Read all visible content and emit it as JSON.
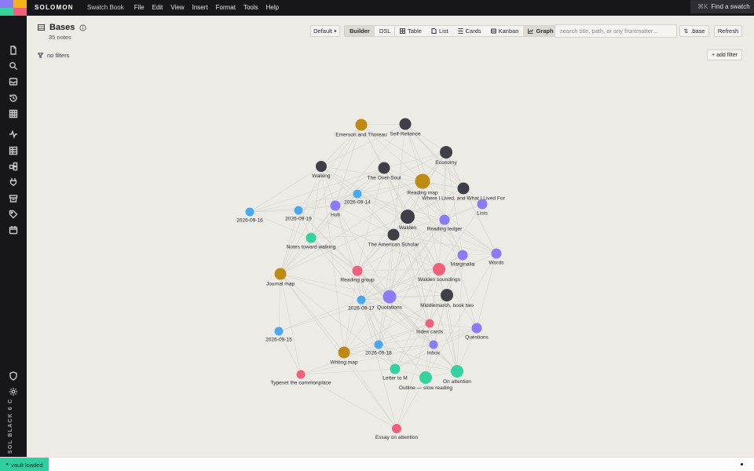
{
  "app": {
    "brand": "SOLOMON",
    "menu": [
      "Swatch Book",
      "File",
      "Edit",
      "View",
      "Insert",
      "Format",
      "Tools",
      "Help"
    ],
    "find_shortcut": "⌘K",
    "find_label": "Find a swatch",
    "logo_colors": [
      "#8b7cf6",
      "#f2b21a",
      "#34d39e",
      "#f0607a"
    ]
  },
  "rail": {
    "icons": [
      "file-icon",
      "search-icon",
      "inbox-icon",
      "history-icon",
      "grid-icon",
      "activity-icon",
      "table-icon",
      "blocks-icon",
      "plug-icon",
      "archive-icon",
      "tag-icon",
      "calendar-icon"
    ],
    "bottom_icons": [
      "shield-icon",
      "gear-icon"
    ],
    "footer": "SOL BLACK 6 C"
  },
  "header": {
    "title": "Bases",
    "count": "35 notes",
    "preset": "Default",
    "modes": [
      "Builder",
      "DSL"
    ],
    "active_mode": "Builder",
    "views": [
      "Table",
      "List",
      "Cards",
      "Kanban",
      "Graph"
    ],
    "active_view": "Graph",
    "search_placeholder": "search title, path, or any frontmatter...",
    "base_button": ".base",
    "refresh_button": "Refresh"
  },
  "filters": {
    "label": "no filters",
    "add_label": "+ add filter"
  },
  "colors": {
    "dark": "#3f3f47",
    "gold": "#bf8a14",
    "blue": "#4aa8f1",
    "purple": "#8b7cf6",
    "green": "#34d39e",
    "pink": "#f0607a",
    "edge": "#d6d4cd"
  },
  "graph": {
    "nodes": [
      {
        "id": "emerson",
        "label": "Emerson and Thoreau",
        "kind": "gold"
      },
      {
        "id": "self",
        "label": "Self-Reliance",
        "kind": "dark"
      },
      {
        "id": "economy",
        "label": "Economy",
        "kind": "dark"
      },
      {
        "id": "walking",
        "label": "Walking",
        "kind": "dark"
      },
      {
        "id": "oversoul",
        "label": "The Over-Soul",
        "kind": "dark"
      },
      {
        "id": "readingmap",
        "label": "Reading map",
        "kind": "gold"
      },
      {
        "id": "whereilived",
        "label": "Where I Lived, and What I Lived For",
        "kind": "dark"
      },
      {
        "id": "d14",
        "label": "2026-09-14",
        "kind": "blue"
      },
      {
        "id": "hub",
        "label": "Hub",
        "kind": "purple"
      },
      {
        "id": "lists",
        "label": "Lists",
        "kind": "purple"
      },
      {
        "id": "d16",
        "label": "2026-09-16",
        "kind": "blue"
      },
      {
        "id": "d19",
        "label": "2026-09-19",
        "kind": "blue"
      },
      {
        "id": "walden",
        "label": "Walden",
        "kind": "dark"
      },
      {
        "id": "ledger",
        "label": "Reading ledger",
        "kind": "purple"
      },
      {
        "id": "scholar",
        "label": "The American Scholar",
        "kind": "dark"
      },
      {
        "id": "notes",
        "label": "Notes toward walking",
        "kind": "green"
      },
      {
        "id": "marginalia",
        "label": "Marginalia",
        "kind": "purple"
      },
      {
        "id": "words",
        "label": "Words",
        "kind": "purple"
      },
      {
        "id": "journal",
        "label": "Journal map",
        "kind": "gold"
      },
      {
        "id": "group",
        "label": "Reading group",
        "kind": "pink"
      },
      {
        "id": "soundings",
        "label": "Walden soundings",
        "kind": "pink"
      },
      {
        "id": "quotations",
        "label": "Quotations",
        "kind": "purple"
      },
      {
        "id": "middlemarch",
        "label": "Middlemarch, book two",
        "kind": "dark"
      },
      {
        "id": "d17",
        "label": "2026-09-17",
        "kind": "blue"
      },
      {
        "id": "indexcards",
        "label": "Index cards",
        "kind": "pink"
      },
      {
        "id": "questions",
        "label": "Questions",
        "kind": "purple"
      },
      {
        "id": "d15",
        "label": "2026-09-15",
        "kind": "blue"
      },
      {
        "id": "inbox",
        "label": "Inbox",
        "kind": "purple"
      },
      {
        "id": "d18",
        "label": "2026-09-18",
        "kind": "blue"
      },
      {
        "id": "writingmap",
        "label": "Writing map",
        "kind": "gold"
      },
      {
        "id": "letter",
        "label": "Letter to M",
        "kind": "green"
      },
      {
        "id": "attention",
        "label": "On attention",
        "kind": "green"
      },
      {
        "id": "outline",
        "label": "Outline — slow reading",
        "kind": "green"
      },
      {
        "id": "typeset",
        "label": "Typeset the commonplace",
        "kind": "pink"
      },
      {
        "id": "essay",
        "label": "Essay on attention",
        "kind": "pink"
      }
    ]
  },
  "status": {
    "vault": "vault loaded"
  }
}
